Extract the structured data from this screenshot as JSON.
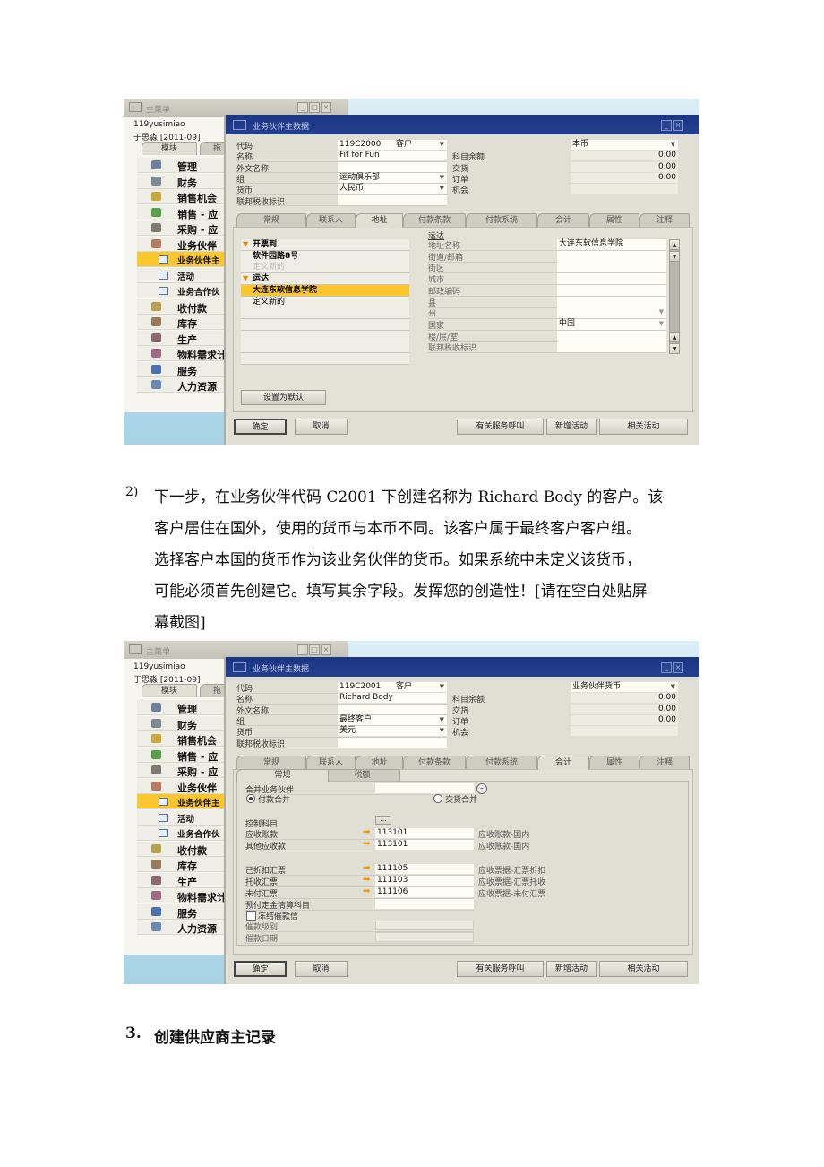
{
  "screenshot1": {
    "main_menu": {
      "title": "主菜单",
      "user": "119yusimiao",
      "user_period": "于思淼  [2011-09]",
      "tabs": [
        "模块",
        "拖"
      ],
      "items": [
        {
          "label": "管理",
          "icon": "admin-icon",
          "color": "#6f7fa0"
        },
        {
          "label": "财务",
          "icon": "finance-icon",
          "color": "#7e8890"
        },
        {
          "label": "销售机会",
          "icon": "opportunity-icon",
          "color": "#c9a83a"
        },
        {
          "label": "销售 - 应",
          "icon": "sales-icon",
          "color": "#5aa04a"
        },
        {
          "label": "采购 - 应",
          "icon": "purchase-icon",
          "color": "#7e7a70"
        },
        {
          "label": "业务伙伴",
          "icon": "partner-icon",
          "color": "#b87a60"
        },
        {
          "label": "业务伙伴主",
          "icon": "form-icon",
          "sub": true,
          "selected": true
        },
        {
          "label": "活动",
          "icon": "form-icon",
          "sub": true
        },
        {
          "label": "业务合作伙",
          "icon": "folder-icon",
          "sub": true
        },
        {
          "label": "收付款",
          "icon": "payment-icon",
          "color": "#b8a050"
        },
        {
          "label": "库存",
          "icon": "inventory-icon",
          "color": "#9a7a5a"
        },
        {
          "label": "生产",
          "icon": "production-icon",
          "color": "#8a6a6a"
        },
        {
          "label": "物料需求计",
          "icon": "mrp-icon",
          "color": "#a06a80"
        },
        {
          "label": "服务",
          "icon": "service-icon",
          "color": "#4a70b0"
        },
        {
          "label": "人力资源",
          "icon": "hr-icon",
          "color": "#6a88b0"
        }
      ]
    },
    "bp_window": {
      "title": "业务伙伴主数据",
      "fields": [
        {
          "label": "代码",
          "value": "119C2000",
          "type": "客户",
          "dropdown": true
        },
        {
          "label": "名称",
          "value": "Fit for Fun"
        },
        {
          "label": "外文名称",
          "value": ""
        },
        {
          "label": "组",
          "value": "运动俱乐部",
          "dropdown": true
        },
        {
          "label": "货币",
          "value": "人民币",
          "dropdown": true
        },
        {
          "label": "联邦税收标识",
          "value": ""
        }
      ],
      "currency_select": "本币",
      "balances": [
        {
          "label": "科目余额",
          "value": "0.00"
        },
        {
          "label": "交货",
          "value": "0.00"
        },
        {
          "label": "订单",
          "value": "0.00"
        },
        {
          "label": "机会",
          "value": ""
        }
      ],
      "tabs": [
        "常规",
        "联系人",
        "地址",
        "付款条款",
        "付款系统",
        "会计",
        "属性",
        "注释"
      ],
      "active_tab": 2,
      "address": {
        "list": [
          {
            "text": "开票到",
            "header": true
          },
          {
            "text": "软件园路8号",
            "bold": true
          },
          {
            "text": "定义新的",
            "muted": true
          },
          {
            "text": "运达",
            "header": true
          },
          {
            "text": "大连东软信息学院",
            "bold": true,
            "selected": true
          },
          {
            "text": "定义新的"
          },
          {
            "text": ""
          },
          {
            "text": ""
          },
          {
            "text": ""
          },
          {
            "text": ""
          },
          {
            "text": ""
          }
        ],
        "section": "运达",
        "fields": [
          {
            "label": "地址名称",
            "value": "大连东软信息学院"
          },
          {
            "label": "街道/邮箱",
            "value": ""
          },
          {
            "label": "街区",
            "value": ""
          },
          {
            "label": "城市",
            "value": ""
          },
          {
            "label": "邮政编码",
            "value": ""
          },
          {
            "label": "县",
            "value": ""
          },
          {
            "label": "州",
            "value": "",
            "dropdown": true
          },
          {
            "label": "国家",
            "value": "中国",
            "dropdown": true
          },
          {
            "label": "楼/层/室",
            "value": ""
          },
          {
            "label": "联邦税收标识",
            "value": ""
          }
        ],
        "set_default_button": "设置为默认"
      },
      "buttons": {
        "ok": "确定",
        "cancel": "取消",
        "service_calls": "有关服务呼叫",
        "new_activity": "新增活动",
        "related_activities": "相关活动"
      }
    }
  },
  "paragraph": {
    "number": "2)",
    "lines": [
      "下一步，在业务伙伴代码 C2001 下创建名称为 Richard Body 的客户。该",
      "客户居住在国外，使用的货币与本币不同。该客户属于最终客户客户组。",
      "选择客户本国的货币作为该业务伙伴的货币。如果系统中未定义该货币，",
      "可能必须首先创建它。填写其余字段。发挥您的创造性！[请在空白处贴屏",
      "幕截图]"
    ]
  },
  "screenshot2": {
    "main_menu": {
      "title": "主菜单",
      "user": "119yusimiao",
      "user_period": "于思淼  [2011-09]",
      "tabs": [
        "模块",
        "拖"
      ],
      "items": [
        {
          "label": "管理",
          "icon": "admin-icon",
          "color": "#6f7fa0"
        },
        {
          "label": "财务",
          "icon": "finance-icon",
          "color": "#7e8890"
        },
        {
          "label": "销售机会",
          "icon": "opportunity-icon",
          "color": "#c9a83a"
        },
        {
          "label": "销售 - 应",
          "icon": "sales-icon",
          "color": "#5aa04a"
        },
        {
          "label": "采购 - 应",
          "icon": "purchase-icon",
          "color": "#7e7a70"
        },
        {
          "label": "业务伙伴",
          "icon": "partner-icon",
          "color": "#b87a60"
        },
        {
          "label": "业务伙伴主",
          "icon": "form-icon",
          "sub": true,
          "selected": true
        },
        {
          "label": "活动",
          "icon": "form-icon",
          "sub": true
        },
        {
          "label": "业务合作伙",
          "icon": "folder-icon",
          "sub": true
        },
        {
          "label": "收付款",
          "icon": "payment-icon",
          "color": "#b8a050"
        },
        {
          "label": "库存",
          "icon": "inventory-icon",
          "color": "#9a7a5a"
        },
        {
          "label": "生产",
          "icon": "production-icon",
          "color": "#8a6a6a"
        },
        {
          "label": "物料需求计",
          "icon": "mrp-icon",
          "color": "#a06a80"
        },
        {
          "label": "服务",
          "icon": "service-icon",
          "color": "#4a70b0"
        },
        {
          "label": "人力资源",
          "icon": "hr-icon",
          "color": "#6a88b0"
        }
      ]
    },
    "bp_window": {
      "title": "业务伙伴主数据",
      "fields": [
        {
          "label": "代码",
          "value": "119C2001",
          "type": "客户",
          "dropdown": true
        },
        {
          "label": "名称",
          "value": "Richard Body"
        },
        {
          "label": "外文名称",
          "value": ""
        },
        {
          "label": "组",
          "value": "最终客户",
          "dropdown": true
        },
        {
          "label": "货币",
          "value": "美元",
          "dropdown": true
        },
        {
          "label": "联邦税收标识",
          "value": ""
        }
      ],
      "currency_select": "业务伙伴货币",
      "balances": [
        {
          "label": "科目余额",
          "value": "0.00"
        },
        {
          "label": "交货",
          "value": "0.00"
        },
        {
          "label": "订单",
          "value": "0.00"
        },
        {
          "label": "机会",
          "value": ""
        }
      ],
      "tabs": [
        "常规",
        "联系人",
        "地址",
        "付款条款",
        "付款系统",
        "会计",
        "属性",
        "注释"
      ],
      "active_tab": 5,
      "accounting": {
        "subtabs": [
          "常规",
          "税额"
        ],
        "consolidating_bp_label": "合并业务伙伴",
        "consolidating_bp_value": "",
        "radio_payment": "付款合并",
        "radio_delivery": "交货合并",
        "radio_selected": "payment",
        "control_accounts_label": "控制科目",
        "control_accounts_button": "...",
        "accounts": [
          {
            "label": "应收账款",
            "code": "113101",
            "desc": "应收账款-国内"
          },
          {
            "label": "其他应收款",
            "code": "113101",
            "desc": "应收账款-国内"
          },
          {
            "label": "已折扣汇票",
            "code": "111105",
            "desc": "应收票据-汇票折扣"
          },
          {
            "label": "托收汇票",
            "code": "111103",
            "desc": "应收票据-汇票托收"
          },
          {
            "label": "未付汇票",
            "code": "111106",
            "desc": "应收票据-未付汇票"
          }
        ],
        "down_payment_label": "预付定金清算科目",
        "down_payment_value": "",
        "block_dunning_label": "冻结催款信",
        "block_dunning_checked": false,
        "dunning_level_label": "催款级别",
        "dunning_level_value": "",
        "dunning_date_label": "催款日期",
        "dunning_date_value": ""
      },
      "buttons": {
        "ok": "确定",
        "cancel": "取消",
        "service_calls": "有关服务呼叫",
        "new_activity": "新增活动",
        "related_activities": "相关活动"
      }
    }
  },
  "heading": {
    "number": "3.",
    "text": "创建供应商主记录"
  }
}
